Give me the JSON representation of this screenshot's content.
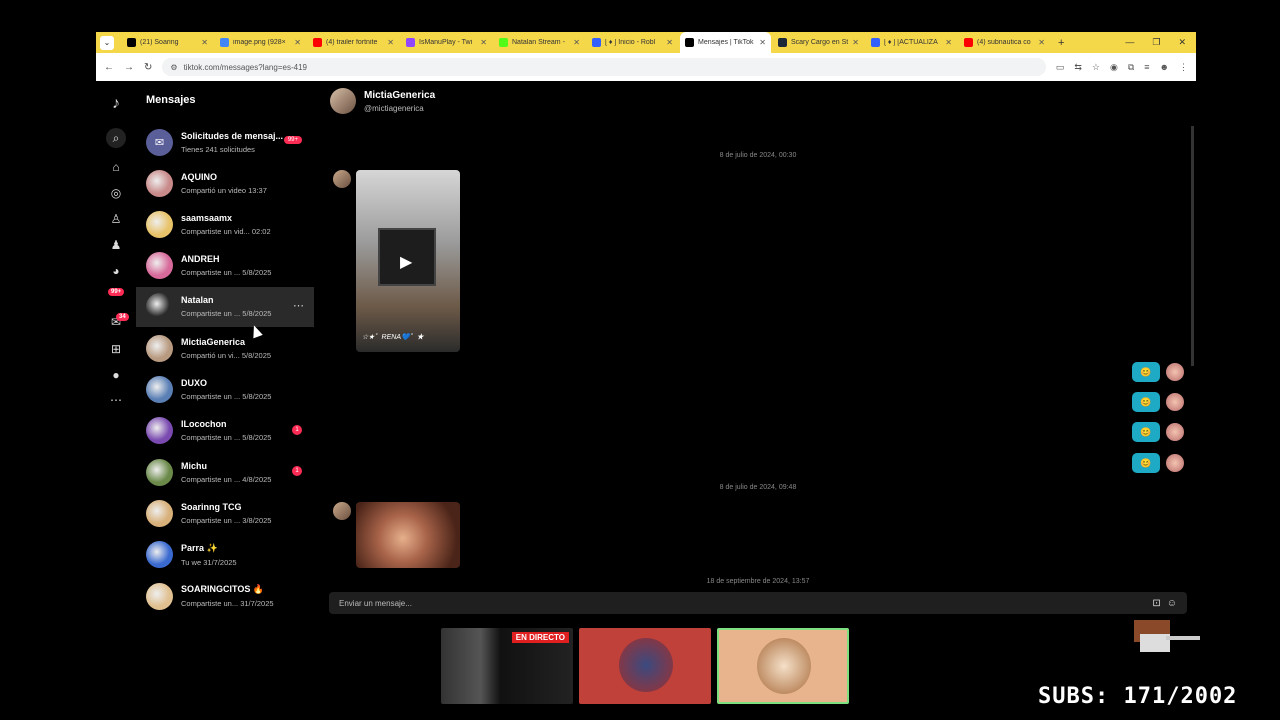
{
  "browser": {
    "tabs": [
      {
        "title": "(21) Soaring",
        "color": "#000000",
        "active": false
      },
      {
        "title": "image.png (928×",
        "color": "#4285f4",
        "active": false
      },
      {
        "title": "(4) trailer fortnite",
        "color": "#ff0000",
        "active": false
      },
      {
        "title": "IsManuPlay - Twi",
        "color": "#9146ff",
        "active": false
      },
      {
        "title": "Natalan Stream -",
        "color": "#53fc18",
        "active": false
      },
      {
        "title": "[ ♦ ] Inicio - Robl",
        "color": "#335fff",
        "active": false
      },
      {
        "title": "Mensajes | TikTok",
        "color": "#000000",
        "active": true
      },
      {
        "title": "Scary Cargo en St",
        "color": "#1b2838",
        "active": false
      },
      {
        "title": "[ ♦ ] [ACTUALIZA",
        "color": "#335fff",
        "active": false
      },
      {
        "title": "(4) subnautica co",
        "color": "#ff0000",
        "active": false
      }
    ],
    "url": "tiktok.com/messages?lang=es-419"
  },
  "sidebar": {
    "title": "Mensajes",
    "requests": {
      "name": "Solicitudes de mensaj...",
      "preview": "Tienes 241 solicitudes",
      "badge": "99+"
    },
    "conversations": [
      {
        "name": "AQUINO",
        "preview": "Compartió un video 13:37",
        "unread": "",
        "avatar": "#c98a8a"
      },
      {
        "name": "saamsaamx",
        "preview": "Compartiste un vid...  02:02",
        "unread": "",
        "avatar": "#e8c36a"
      },
      {
        "name": "ANDREH",
        "preview": "Compartiste un ...  5/8/2025",
        "unread": "",
        "avatar": "#d76a9a"
      },
      {
        "name": "Natalan",
        "preview": "Compartiste un ...  5/8/2025",
        "unread": "",
        "avatar": "#2a2a2a"
      },
      {
        "name": "MictiaGenerica",
        "preview": "Compartió un vi...  5/8/2025",
        "unread": "",
        "avatar": "#b89a80"
      },
      {
        "name": "DUXO",
        "preview": "Compartiste un ...  5/8/2025",
        "unread": "",
        "avatar": "#5a7fb5"
      },
      {
        "name": "ILocochon",
        "preview": "Compartiste un ...  5/8/2025",
        "unread": "1",
        "avatar": "#7a4ab0"
      },
      {
        "name": "Michu",
        "preview": "Compartiste un ...  4/8/2025",
        "unread": "1",
        "avatar": "#6b8a4a"
      },
      {
        "name": "Soarinng TCG",
        "preview": "Compartiste un ...  3/8/2025",
        "unread": "",
        "avatar": "#d8b07a"
      },
      {
        "name": "Parra ✨",
        "preview": "Tu we  31/7/2025",
        "unread": "",
        "avatar": "#3a6ad0"
      },
      {
        "name": "SOARINGCITOS 🔥",
        "preview": "Compartiste un...  31/7/2025",
        "unread": "",
        "avatar": "#e0c090"
      }
    ]
  },
  "rail": {
    "badge1": "99+",
    "badge2": "34"
  },
  "chat": {
    "name": "MictiaGenerica",
    "handle": "@mictiagenerica",
    "timestamps": [
      "8 de julio de 2024, 00:30",
      "8 de julio de 2024, 09:48",
      "18 de septiembre de 2024, 13:57"
    ],
    "video_caption": "☆★゜RENA💙゜★",
    "input_placeholder": "Enviar un mensaje..."
  },
  "stream": {
    "live_label": "EN DIRECTO",
    "subs": "SUBS: 171/2002"
  }
}
